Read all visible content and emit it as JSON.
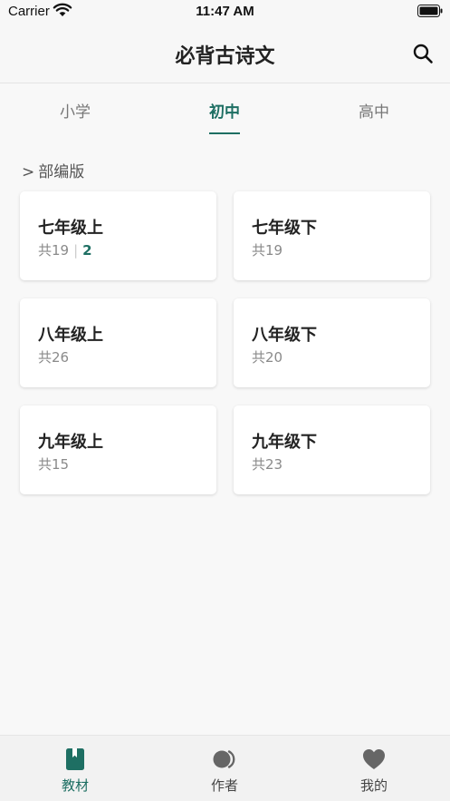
{
  "status_bar": {
    "carrier": "Carrier",
    "time": "11:47 AM"
  },
  "nav": {
    "title": "必背古诗文",
    "search_icon": "search-icon"
  },
  "tabs": [
    {
      "label": "小学",
      "active": false
    },
    {
      "label": "初中",
      "active": true
    },
    {
      "label": "高中",
      "active": false
    }
  ],
  "section": {
    "chevron": ">",
    "title": "部编版"
  },
  "cards": [
    {
      "title": "七年级上",
      "count": "共19",
      "progress": "2"
    },
    {
      "title": "七年级下",
      "count": "共19"
    },
    {
      "title": "八年级上",
      "count": "共26"
    },
    {
      "title": "八年级下",
      "count": "共20"
    },
    {
      "title": "九年级上",
      "count": "共15"
    },
    {
      "title": "九年级下",
      "count": "共23"
    }
  ],
  "tab_bar": [
    {
      "label": "教材",
      "icon": "book-icon",
      "active": true
    },
    {
      "label": "作者",
      "icon": "person-icon",
      "active": false
    },
    {
      "label": "我的",
      "icon": "heart-icon",
      "active": false
    }
  ],
  "colors": {
    "accent": "#1e6f63",
    "muted": "#8a8a8a",
    "inactive_icon": "#666666"
  }
}
